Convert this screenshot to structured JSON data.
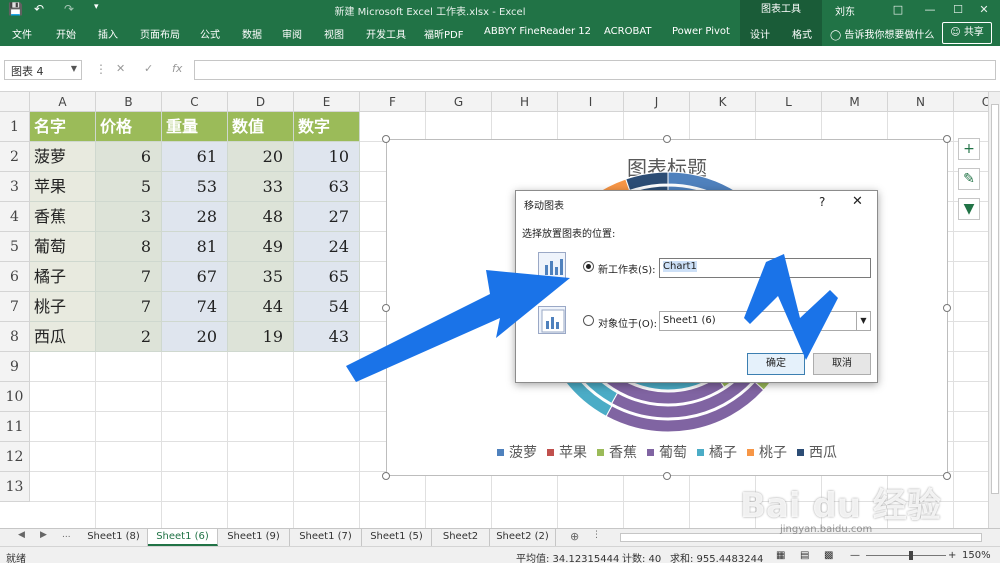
{
  "titlebar": {
    "title": "新建 Microsoft Excel 工作表.xlsx  -  Excel",
    "context_group": "图表工具",
    "user": "刘东",
    "qa_save_icon": "save-icon",
    "qa_undo_icon": "undo-icon",
    "qa_redo_icon": "redo-icon"
  },
  "ribbon": {
    "tabs": [
      "文件",
      "开始",
      "插入",
      "页面布局",
      "公式",
      "数据",
      "审阅",
      "视图",
      "开发工具",
      "福昕PDF",
      "ABBYY FineReader 12",
      "ACROBAT",
      "Power Pivot"
    ],
    "context_tabs": [
      "设计",
      "格式"
    ],
    "tell_me": "告诉我你想要做什么",
    "share": "共享"
  },
  "formula_bar": {
    "name_box": "图表 4",
    "fx": "fx",
    "value": ""
  },
  "columns": [
    "A",
    "B",
    "C",
    "D",
    "E",
    "F",
    "G",
    "H",
    "I",
    "J",
    "K",
    "L",
    "M",
    "N",
    "O"
  ],
  "rows": [
    "1",
    "2",
    "3",
    "4",
    "5",
    "6",
    "7",
    "8",
    "9",
    "10",
    "11",
    "12",
    "13"
  ],
  "table": {
    "headers": [
      "名字",
      "价格",
      "重量",
      "数值",
      "数字"
    ],
    "rows": [
      [
        "菠萝",
        "6",
        "61",
        "20",
        "10"
      ],
      [
        "苹果",
        "5",
        "53",
        "33",
        "63"
      ],
      [
        "香蕉",
        "3",
        "28",
        "48",
        "27"
      ],
      [
        "葡萄",
        "8",
        "81",
        "49",
        "24"
      ],
      [
        "橘子",
        "7",
        "67",
        "35",
        "65"
      ],
      [
        "桃子",
        "7",
        "74",
        "44",
        "54"
      ],
      [
        "西瓜",
        "2",
        "20",
        "19",
        "43"
      ]
    ]
  },
  "chart_data": {
    "type": "pie",
    "title": "图表标题",
    "categories": [
      "菠萝",
      "苹果",
      "香蕉",
      "葡萄",
      "橘子",
      "桃子",
      "西瓜"
    ],
    "series": [
      {
        "values": [
          6,
          5,
          3,
          8,
          7,
          7,
          2
        ]
      },
      {
        "values": [
          61,
          53,
          28,
          81,
          67,
          74,
          20
        ]
      },
      {
        "values": [
          20,
          33,
          48,
          49,
          35,
          44,
          19
        ]
      },
      {
        "values": [
          10,
          63,
          27,
          24,
          65,
          54,
          43
        ]
      }
    ],
    "legend_position": "bottom",
    "colors": [
      "#4f81bd",
      "#c0504d",
      "#9bbb59",
      "#8064a2",
      "#4bacc6",
      "#f79646",
      "#2c4d75"
    ]
  },
  "chart_side_buttons": [
    "plus-icon",
    "brush-icon",
    "filter-icon"
  ],
  "dialog": {
    "title": "移动图表",
    "help": "?",
    "close": "✕",
    "prompt": "选择放置图表的位置:",
    "option_new": "新工作表(S):",
    "option_new_value": "Chart1",
    "option_obj": "对象位于(O):",
    "option_obj_value": "Sheet1 (6)",
    "ok": "确定",
    "cancel": "取消"
  },
  "sheet_tabs": [
    "Sheet1 (8)",
    "Sheet1 (6)",
    "Sheet1 (9)",
    "Sheet1 (7)",
    "Sheet1 (5)",
    "Sheet2",
    "Sheet2 (2)"
  ],
  "active_sheet": "Sheet1 (6)",
  "status": {
    "ready": "就绪",
    "average": "平均值: 34.12315444",
    "count": "计数: 40",
    "sum": "求和: 955.4483244",
    "zoom": "150%"
  },
  "watermark": {
    "text": "Bai du 经验",
    "url": "jingyan.baidu.com"
  },
  "accent": "#217346",
  "annotation_arrow_color": "#1a73e8"
}
